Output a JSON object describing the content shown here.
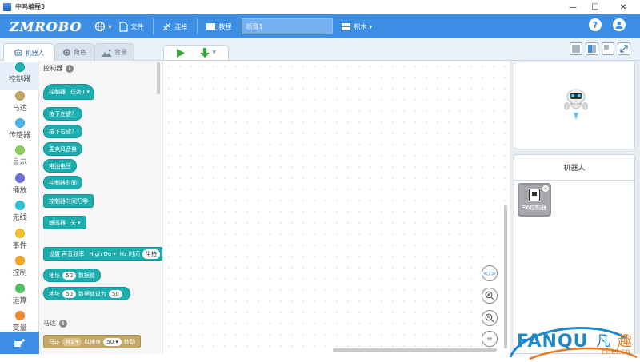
{
  "window": {
    "title": "中鸣编程3",
    "minimize": "—",
    "maximize": "☐",
    "close": "✕"
  },
  "header": {
    "logo": "ZMROBO",
    "menu": {
      "language": "",
      "file": "文件",
      "connect": "连接",
      "tutorial": "教程",
      "blocks_mode": "积木"
    },
    "project_name": "项目1",
    "help": "?",
    "user": "user"
  },
  "tabs": {
    "robot": "机器人",
    "role": "角色",
    "background": "背景"
  },
  "categories": [
    {
      "label": "控制器",
      "color": "#1dadae"
    },
    {
      "label": "马达",
      "color": "#c4a868"
    },
    {
      "label": "传感器",
      "color": "#4fb3e8"
    },
    {
      "label": "显示",
      "color": "#8dcf5a"
    },
    {
      "label": "播放",
      "color": "#6e6fd8"
    },
    {
      "label": "无线",
      "color": "#2ec2d6"
    },
    {
      "label": "事件",
      "color": "#f6c12b"
    },
    {
      "label": "控制",
      "color": "#f5a623"
    },
    {
      "label": "运算",
      "color": "#4ec262"
    },
    {
      "label": "变量",
      "color": "#f28b2f"
    }
  ],
  "palette": {
    "section_controller": "控制器",
    "section_motor": "马达",
    "info": "i",
    "blocks": {
      "controller_task": {
        "a": "控制器",
        "b": "任务1"
      },
      "left_pressed": "按下左键？",
      "right_pressed": "按下右键？",
      "mic_volume": "麦克风音量",
      "battery": "电池电压",
      "timer": "控制器时间",
      "timer_reset": "控制器时间归零",
      "buzzer": {
        "a": "蜂鸣器",
        "b": "关"
      },
      "tone": {
        "a": "设置 声音频率",
        "note": "High Do",
        "hz": "Hz 时间",
        "beat": "半拍"
      },
      "addr_read": {
        "a": "地址",
        "v": "50",
        "b": "数据值"
      },
      "addr_write": {
        "a": "地址",
        "v": "50",
        "b": "数据值设为",
        "v2": "50"
      },
      "motor": {
        "a": "马达",
        "port": "M1",
        "b": "以速度",
        "speed": "50",
        "c": "转动"
      }
    }
  },
  "workspace": {
    "zoom_code": "</>",
    "zoom_in": "+",
    "zoom_out": "−",
    "reset": "="
  },
  "right": {
    "robot_header": "机器人",
    "device": "E6控制器",
    "device_close": "×"
  },
  "watermark": {
    "latin": "FANQU",
    "cn1": "凡",
    "cn2": "趣",
    "url": "cuel.cn"
  }
}
